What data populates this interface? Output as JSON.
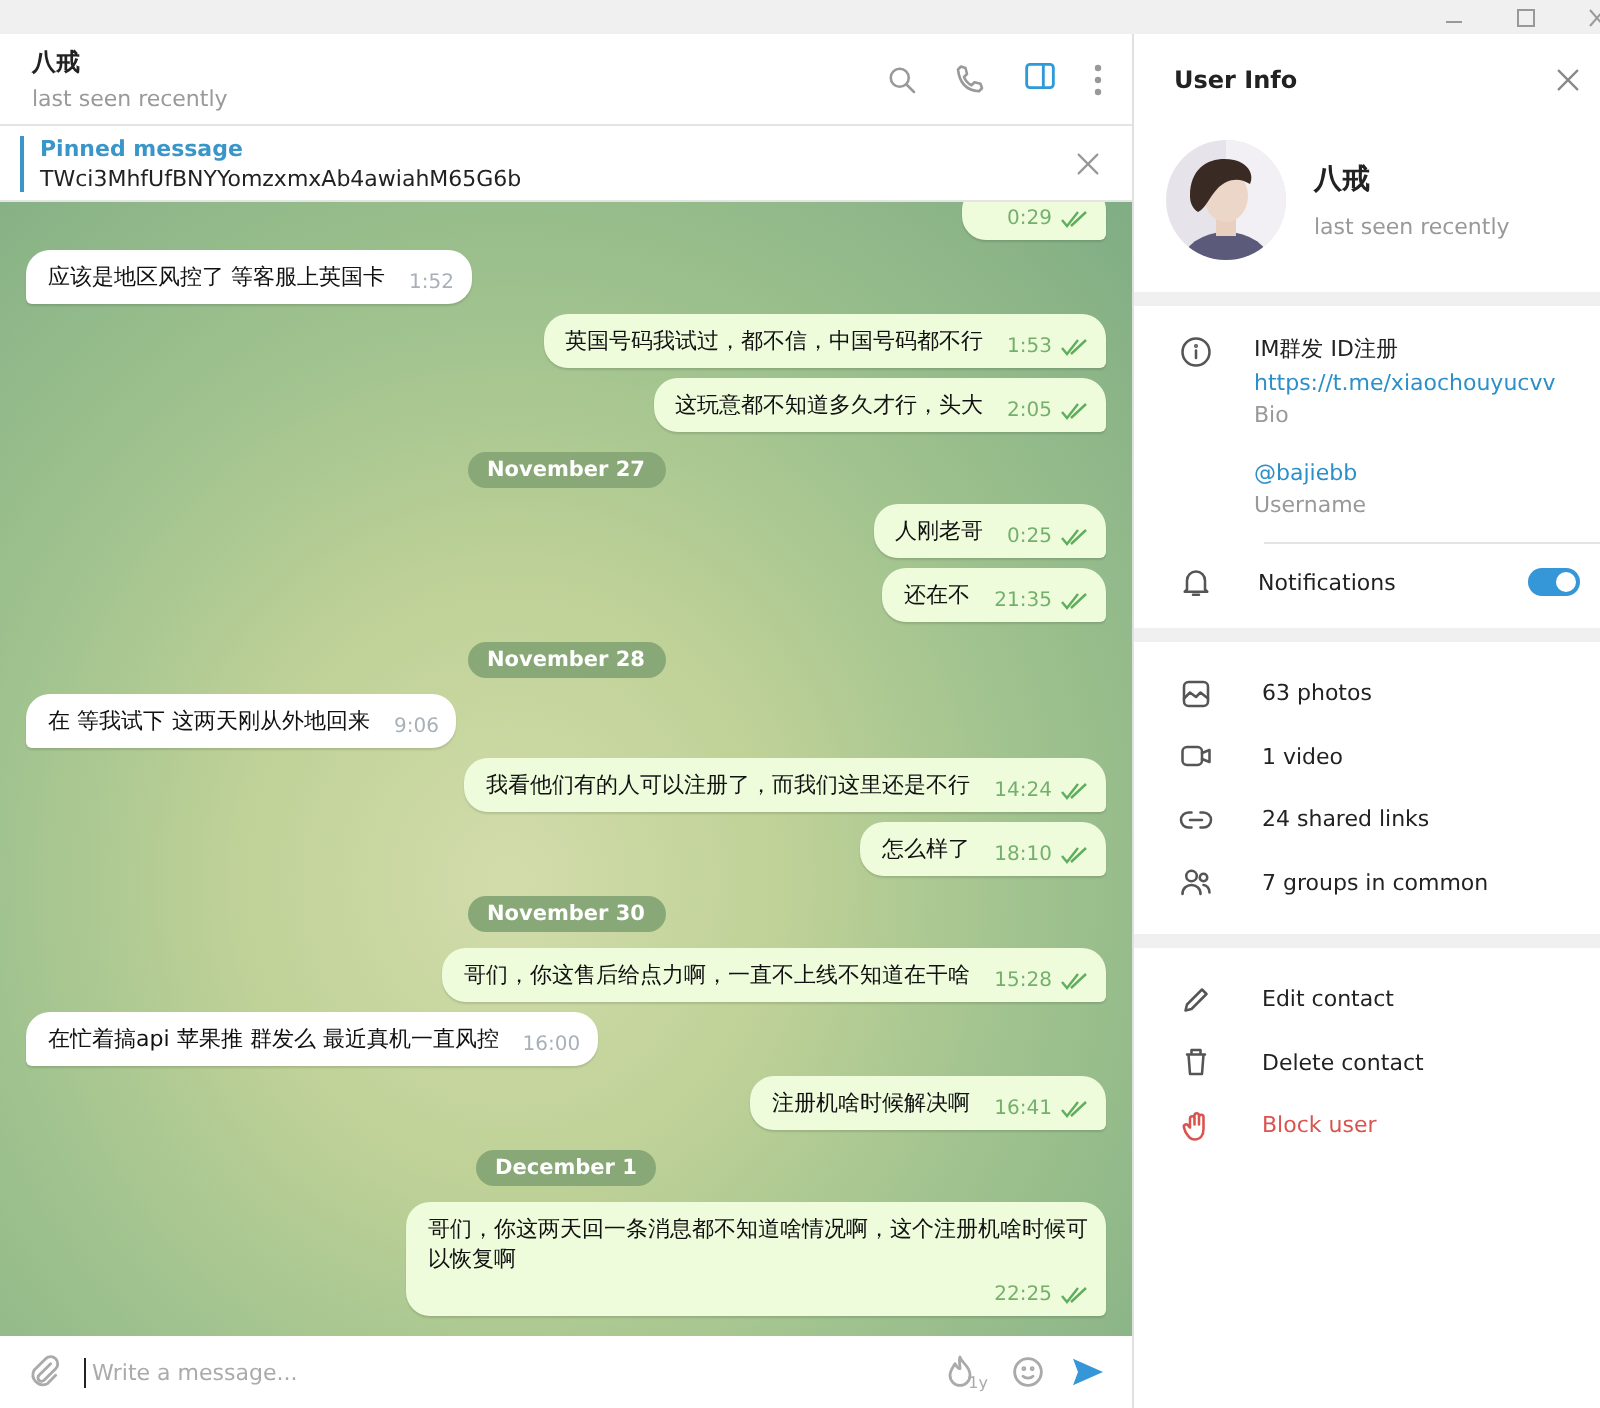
{
  "chat": {
    "title": "八戒",
    "status": "last seen recently",
    "info_panel_open": true
  },
  "pinned": {
    "label": "Pinned message",
    "text": "TWci3MhfUfBNYYomzxmxAb4awiahM65G6b"
  },
  "messages": [
    {
      "kind": "out",
      "time": "0:29",
      "read": true
    },
    {
      "kind": "in",
      "text": "应该是地区风控了 等客服上英国卡",
      "time": "1:52"
    },
    {
      "kind": "out",
      "text": "英国号码我试过，都不信，中国号码都不行",
      "time": "1:53",
      "read": true
    },
    {
      "kind": "out",
      "text": "这玩意都不知道多久才行，头大",
      "time": "2:05",
      "read": true
    },
    {
      "kind": "date",
      "text": "November 27"
    },
    {
      "kind": "out",
      "text": "人刚老哥",
      "time": "0:25",
      "read": true
    },
    {
      "kind": "out",
      "text": "还在不",
      "time": "21:35",
      "read": true
    },
    {
      "kind": "date",
      "text": "November 28"
    },
    {
      "kind": "in",
      "text": "在 等我试下 这两天刚从外地回来",
      "time": "9:06"
    },
    {
      "kind": "out",
      "text": "我看他们有的人可以注册了，而我们这里还是不行",
      "time": "14:24",
      "read": true
    },
    {
      "kind": "out",
      "text": "怎么样了",
      "time": "18:10",
      "read": true
    },
    {
      "kind": "date",
      "text": "November 30"
    },
    {
      "kind": "out",
      "text": "哥们，你这售后给点力啊，一直不上线不知道在干啥",
      "time": "15:28",
      "read": true
    },
    {
      "kind": "in",
      "text": "在忙着搞api 苹果推 群发么 最近真机一直风控",
      "time": "16:00"
    },
    {
      "kind": "out",
      "text": "注册机啥时候解决啊",
      "time": "16:41",
      "read": true
    },
    {
      "kind": "date",
      "text": "December 1"
    },
    {
      "kind": "out",
      "text": "哥们，你这两天回一条消息都不知道啥情况啊，这个注册机啥时候可以恢复啊",
      "time": "22:25",
      "read": true
    }
  ],
  "composer": {
    "placeholder": "Write a message...",
    "timer_label": "1y"
  },
  "user_info": {
    "title": "User Info",
    "name": "八戒",
    "status": "last seen recently",
    "bio_text": "IM群发 ID注册",
    "bio_link": "https://t.me/xiaochouyucvv",
    "bio_label": "Bio",
    "username": "@bajiebb",
    "username_label": "Username",
    "notifications": {
      "label": "Notifications",
      "on": true
    },
    "media": [
      {
        "kind": "photos",
        "label": "63 photos"
      },
      {
        "kind": "video",
        "label": "1 video"
      },
      {
        "kind": "links",
        "label": "24 shared links"
      },
      {
        "kind": "groups",
        "label": "7 groups in common"
      }
    ],
    "actions": [
      {
        "kind": "edit",
        "label": "Edit contact"
      },
      {
        "kind": "delete",
        "label": "Delete contact"
      },
      {
        "kind": "block",
        "label": "Block user"
      }
    ]
  }
}
